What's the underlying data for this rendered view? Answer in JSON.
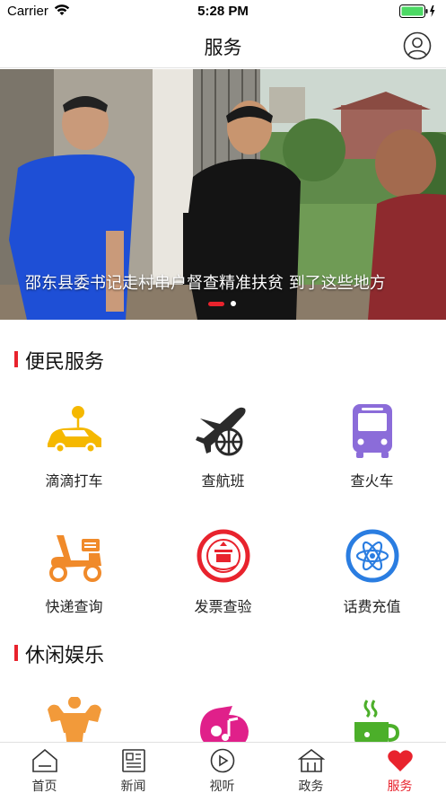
{
  "status_bar": {
    "carrier": "Carrier",
    "time": "5:28 PM"
  },
  "nav": {
    "title": "服务",
    "profile_icon": "user-circle-icon"
  },
  "banner": {
    "caption": "邵东县委书记走村串户督查精准扶贫 到了这些地方",
    "page_count": 2,
    "active_page": 1
  },
  "sections": [
    {
      "title": "便民服务",
      "items": [
        {
          "label": "滴滴打车",
          "icon": "car-pin-icon"
        },
        {
          "label": "查航班",
          "icon": "airplane-globe-icon"
        },
        {
          "label": "查火车",
          "icon": "bus-icon"
        },
        {
          "label": "快递查询",
          "icon": "scooter-icon"
        },
        {
          "label": "发票查验",
          "icon": "emblem-icon"
        },
        {
          "label": "话费充值",
          "icon": "atom-icon"
        }
      ]
    },
    {
      "title": "休闲娱乐",
      "items": [
        {
          "label": "",
          "icon": "muscle-icon"
        },
        {
          "label": "",
          "icon": "music-icon"
        },
        {
          "label": "",
          "icon": "tea-cup-icon"
        }
      ]
    }
  ],
  "tabs": [
    {
      "label": "首页",
      "icon": "home-icon",
      "active": false
    },
    {
      "label": "新闻",
      "icon": "news-icon",
      "active": false
    },
    {
      "label": "视听",
      "icon": "play-icon",
      "active": false
    },
    {
      "label": "政务",
      "icon": "government-icon",
      "active": false
    },
    {
      "label": "服务",
      "icon": "heart-icon",
      "active": true
    }
  ],
  "colors": {
    "accent": "#e8232d",
    "car": "#f5b800",
    "plane": "#2b2b2b",
    "bus": "#8b6cd9",
    "scooter": "#f08a2a",
    "emblem": "#e8232d",
    "atom": "#2a7de1",
    "muscle": "#f29a3a",
    "music": "#e0208a",
    "tea": "#4caf2a"
  }
}
